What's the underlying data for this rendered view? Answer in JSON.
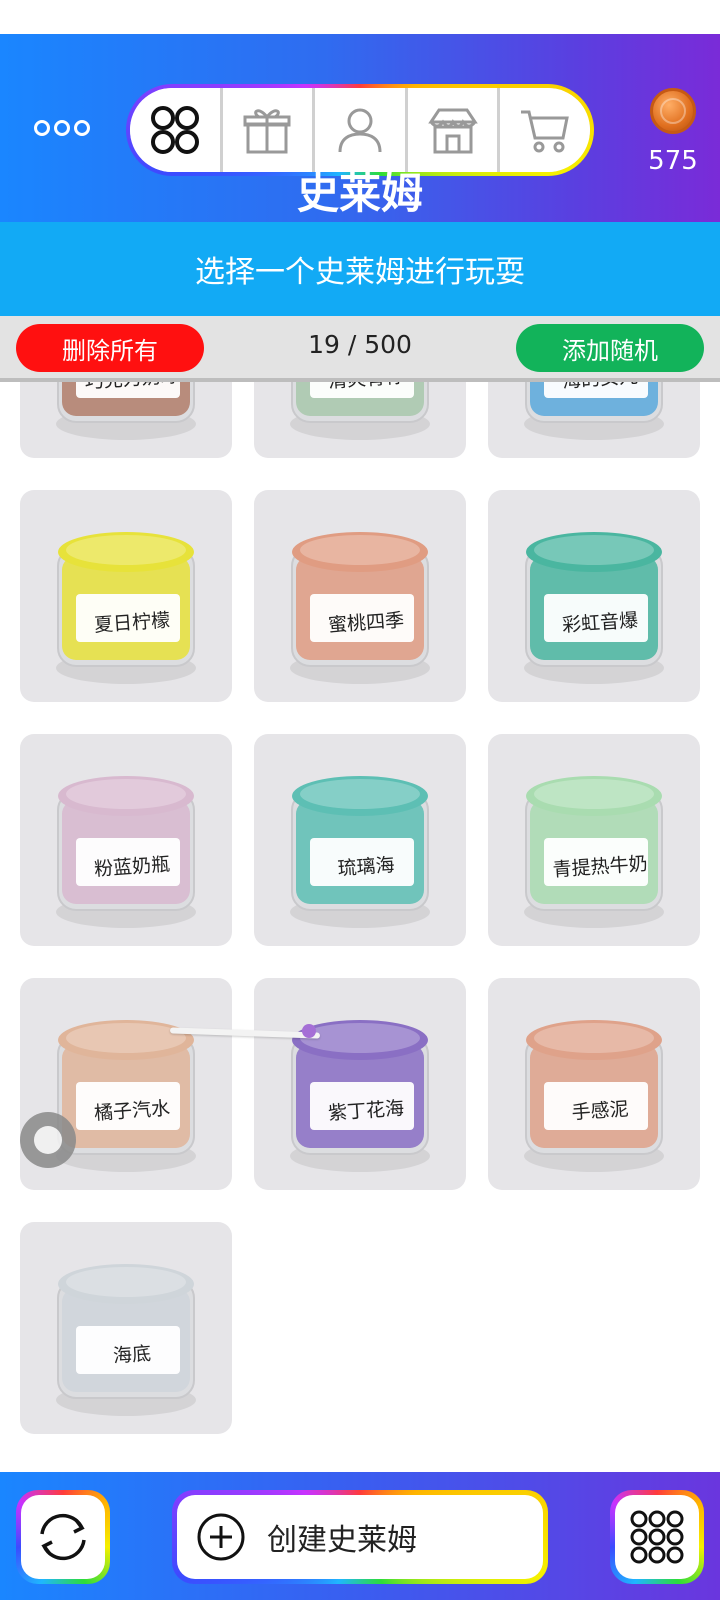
{
  "header": {
    "menu_icon": "more-dots-icon",
    "tabs": [
      {
        "icon": "slime-collection-icon",
        "active": true
      },
      {
        "icon": "gift-icon",
        "active": false
      },
      {
        "icon": "profile-icon",
        "active": false
      },
      {
        "icon": "store-icon",
        "active": false
      },
      {
        "icon": "cart-icon",
        "active": false
      }
    ],
    "coin_icon": "coin-icon",
    "coin_count": "575",
    "title": "史莱姆",
    "gradient_colors": [
      "#1a86ff",
      "#7a2bd8"
    ]
  },
  "subtitle": "选择一个史莱姆进行玩耍",
  "actions": {
    "delete_all": "删除所有",
    "counter": "19 / 500",
    "add_random": "添加随机",
    "delete_color": "#ff1010",
    "random_color": "#12b35a"
  },
  "slimes": [
    {
      "name": "巧克力奶球",
      "color": "#b27e6a"
    },
    {
      "name": "清爽青柠",
      "color": "#a8c8ab"
    },
    {
      "name": "海的女儿",
      "color": "#5aa9dc"
    },
    {
      "name": "夏日柠檬",
      "color": "#e7e23a"
    },
    {
      "name": "蜜桃四季",
      "color": "#e09c82"
    },
    {
      "name": "彩虹音爆",
      "color": "#4ab6a0"
    },
    {
      "name": "粉蓝奶瓶",
      "color": "#d8b9cf"
    },
    {
      "name": "琉璃海",
      "color": "#5dbfb4"
    },
    {
      "name": "青提热牛奶",
      "color": "#a9dcb0"
    },
    {
      "name": "橘子汽水",
      "color": "#e0b59a"
    },
    {
      "name": "紫丁花海",
      "color": "#8a6fc4"
    },
    {
      "name": "手感泥",
      "color": "#dfa28a"
    },
    {
      "name": "海底",
      "color": "#cfd5da"
    }
  ],
  "bottom": {
    "refresh_icon": "refresh-icon",
    "create_icon": "plus-circle-icon",
    "create_label": "创建史莱姆",
    "grid_icon": "grid-menu-icon"
  }
}
